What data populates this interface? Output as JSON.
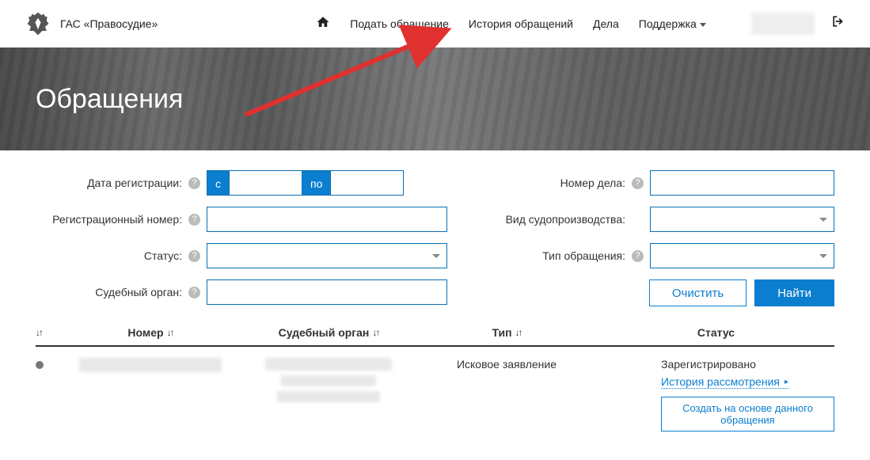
{
  "header": {
    "brand": "ГАС «Правосудие»",
    "nav": {
      "submit": "Подать обращение",
      "history": "История обращений",
      "cases": "Дела",
      "support": "Поддержка"
    }
  },
  "banner": {
    "title": "Обращения"
  },
  "filters": {
    "date_reg_label": "Дата регистрации:",
    "date_from_badge": "с",
    "date_to_badge": "по",
    "reg_num_label": "Регистрационный номер:",
    "status_label": "Статус:",
    "court_label": "Судебный орган:",
    "case_num_label": "Номер дела:",
    "proc_type_label": "Вид судопроизводства:",
    "appeal_type_label": "Тип обращения:",
    "clear_btn": "Очистить",
    "find_btn": "Найти"
  },
  "table": {
    "headers": {
      "number": "Номер",
      "court": "Судебный орган",
      "type": "Тип",
      "status": "Статус"
    },
    "row": {
      "type": "Исковое заявление",
      "status": "Зарегистрировано",
      "history_link": "История рассмотрения",
      "create_btn": "Создать на основе данного обращения"
    }
  }
}
